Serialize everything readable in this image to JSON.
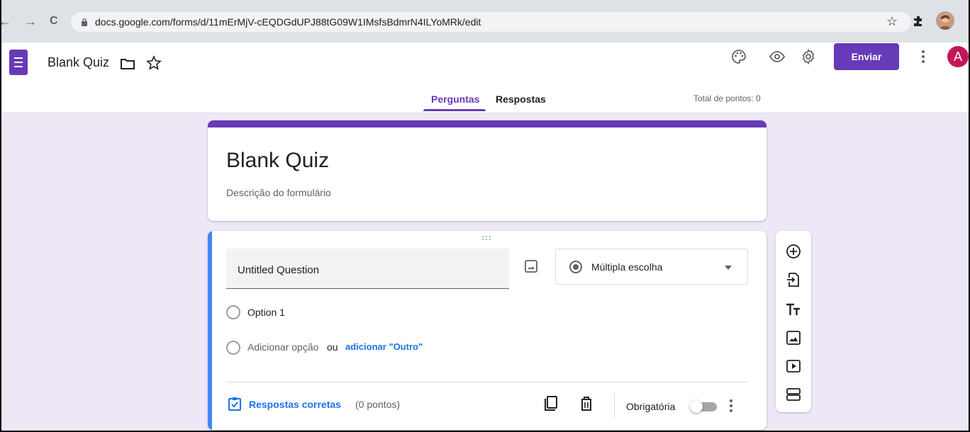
{
  "browser": {
    "url": "docs.google.com/forms/d/11mErMjV-cEQDGdUPJ88tG09W1IMsfsBdmrN4ILYoMRk/edit",
    "nav": {
      "back": "←",
      "forward": "→",
      "reload": "C"
    },
    "icons": [
      "lock-icon",
      "bookmark-star-icon",
      "extensions-icon",
      "profile-avatar"
    ]
  },
  "header": {
    "title": "Blank Quiz",
    "send_label": "Enviar",
    "user_initial": "A",
    "icons": [
      "palette-icon",
      "preview-eye-icon",
      "settings-gear-icon",
      "more-vert-icon"
    ]
  },
  "tabs": [
    {
      "label": "Perguntas",
      "active": true
    },
    {
      "label": "Respostas",
      "active": false
    }
  ],
  "total_points": "Total de pontos: 0",
  "form": {
    "title": "Blank Quiz",
    "description": "Descrição do formulário"
  },
  "question": {
    "title": "Untitled Question",
    "type": "Múltipla escolha",
    "options": [
      "Option 1"
    ],
    "add_option": "Adicionar opção",
    "or_text": "ou",
    "add_other": "adicionar \"Outro\"",
    "answer_key": "Respostas corretas",
    "points": "(0 pontos)",
    "required_label": "Obrigatória",
    "required": false
  },
  "colors": {
    "accent": "#673ab7",
    "question_bar": "#4285f4",
    "link": "#1a73e8",
    "background": "#ede7f6",
    "avatar": "#c2185b"
  }
}
